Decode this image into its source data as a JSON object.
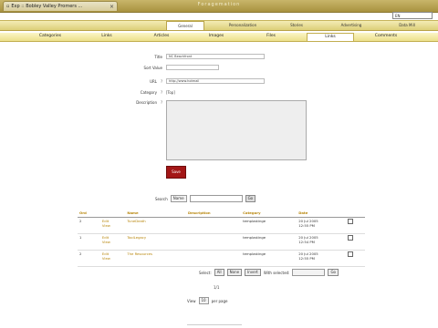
{
  "browser": {
    "tab_title": "Exp :: Bobley Valley Promers ...",
    "window_title": "Foragemation",
    "language": "EN"
  },
  "menu1": [
    "General",
    "Personalization",
    "Stories",
    "Advertising",
    "Data Mill"
  ],
  "menu2": [
    "Categories",
    "Links",
    "Articles",
    "Images",
    "Files",
    "Links",
    "Comments"
  ],
  "form": {
    "title_label": "Title",
    "title_value": "NC Beachfront",
    "sort_label": "Sort Value",
    "url_label": "URL",
    "url_value": "http://www.hotmail",
    "category_label": "Category",
    "category_value": "[Top]",
    "description_label": "Description",
    "help": "?",
    "save_label": "Save"
  },
  "search": {
    "label": "Search",
    "field": "Name",
    "go": "Go"
  },
  "table": {
    "headers": [
      "Ord",
      "Name",
      "Description",
      "Category",
      "Date",
      ""
    ],
    "rows": [
      {
        "ord": "2",
        "edit": "Edit",
        "view": "View",
        "name": "TuneDeath",
        "desc": "",
        "category": "templastinge",
        "date1": "20 Jul 2005",
        "date2": "12:55 PM"
      },
      {
        "ord": "1",
        "edit": "Edit",
        "view": "View",
        "name": "ToolLegacy",
        "desc": "",
        "category": "templastinge",
        "date1": "20 Jul 2005",
        "date2": "12:54 PM"
      },
      {
        "ord": "2",
        "edit": "Edit",
        "view": "View",
        "name": "The Resources",
        "desc": "",
        "category": "templastinge",
        "date1": "20 Jul 2005",
        "date2": "12:55 PM"
      }
    ]
  },
  "select_row": {
    "label": "Select:",
    "all": "All",
    "none": "None",
    "invert": "Invert",
    "with_selected": "With selected:",
    "go": "Go"
  },
  "pager": {
    "text": "1/1"
  },
  "view_row": {
    "view": "View",
    "count": "10",
    "suffix": "per page"
  }
}
